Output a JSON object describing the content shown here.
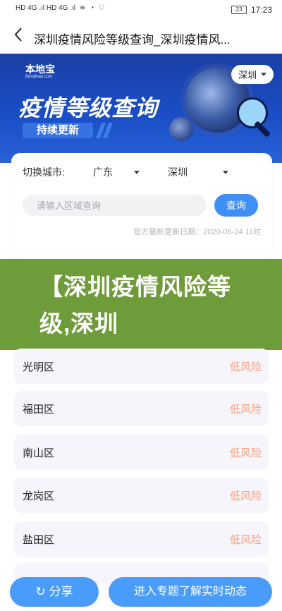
{
  "status_bar": {
    "left_signals": "HD 4G .ıl HD 4G .ıl",
    "battery": "23",
    "time": "17:23"
  },
  "header": {
    "back_icon": "chevron-left-icon",
    "title": "深圳疫情风险等级查询_深圳疫情风..."
  },
  "banner": {
    "logo": "本地宝",
    "logo_sub": "Bendibao.com",
    "title": "疫情等级查询",
    "subtitle": "持续更新",
    "city_selector": "深圳"
  },
  "filter": {
    "switch_label": "切换城市:",
    "province": "广东",
    "city": "深圳",
    "search_placeholder": "请输入区域查询",
    "query_button": "查询",
    "update_text": "官方最新更新日期：2020-06-24 11时"
  },
  "overlay": {
    "text": "【深圳疫情风险等级,深圳"
  },
  "districts": [
    {
      "name": "光明区",
      "risk": "低风险"
    },
    {
      "name": "福田区",
      "risk": "低风险"
    },
    {
      "name": "南山区",
      "risk": "低风险"
    },
    {
      "name": "龙岗区",
      "risk": "低风险"
    },
    {
      "name": "盐田区",
      "risk": "低风险"
    }
  ],
  "bottom": {
    "share_label": "分享",
    "enter_label": "进入专题了解实时动态"
  },
  "colors": {
    "accent": "#4a9cfb",
    "banner": "#1a4fc8",
    "risk_low": "#f2a07d",
    "overlay": "#6f9c3a"
  }
}
